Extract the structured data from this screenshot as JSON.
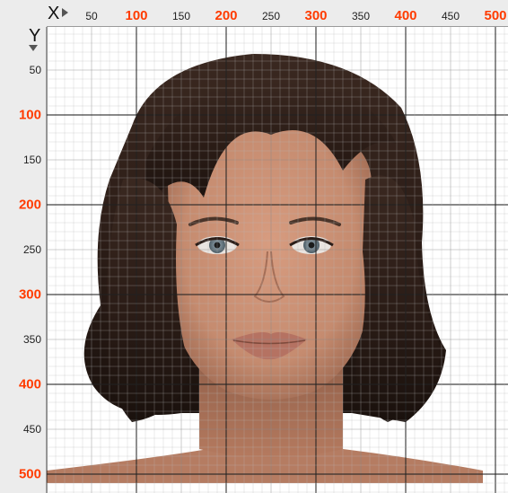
{
  "axes": {
    "x_label": "X",
    "y_label": "Y",
    "major_color": "#ff3b00",
    "minor_color": "#222222",
    "x_ticks": [
      {
        "label": "50",
        "major": false
      },
      {
        "label": "100",
        "major": true
      },
      {
        "label": "150",
        "major": false
      },
      {
        "label": "200",
        "major": true
      },
      {
        "label": "250",
        "major": false
      },
      {
        "label": "300",
        "major": true
      },
      {
        "label": "350",
        "major": false
      },
      {
        "label": "400",
        "major": true
      },
      {
        "label": "450",
        "major": false
      },
      {
        "label": "500",
        "major": true
      }
    ],
    "y_ticks": [
      {
        "label": "50",
        "major": false
      },
      {
        "label": "100",
        "major": true
      },
      {
        "label": "150",
        "major": false
      },
      {
        "label": "200",
        "major": true
      },
      {
        "label": "250",
        "major": false
      },
      {
        "label": "300",
        "major": true
      },
      {
        "label": "350",
        "major": false
      },
      {
        "label": "400",
        "major": true
      },
      {
        "label": "450",
        "major": false
      },
      {
        "label": "500",
        "major": true
      }
    ]
  },
  "image": {
    "subject": "3d-rendered-female-head-portrait",
    "skin_color": "#c98f72",
    "hair_color": "#2c1d17",
    "eye_color": "#6b7c86",
    "lip_color": "#b57262"
  }
}
